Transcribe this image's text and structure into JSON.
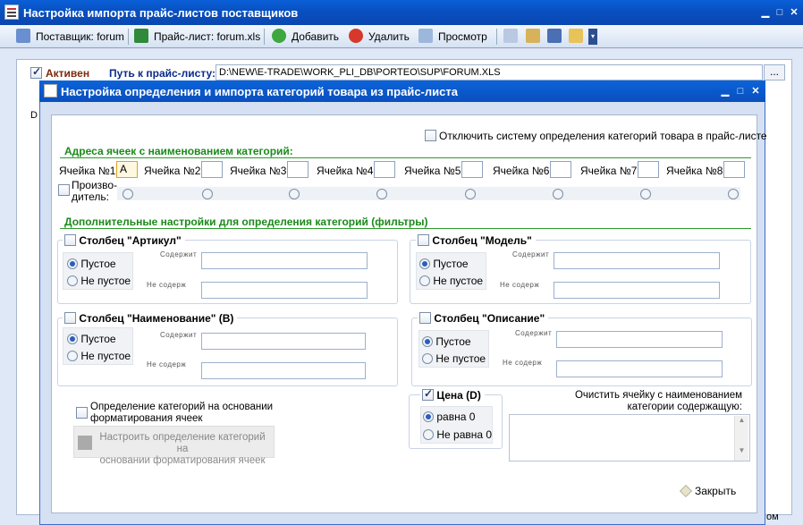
{
  "window": {
    "title": "Настройка импорта прайс-листов поставщиков"
  },
  "toolbar": {
    "supplier": "Поставщик: forum",
    "pricelist": "Прайс-лист: forum.xls",
    "add": "Добавить",
    "delete": "Удалить",
    "view": "Просмотр"
  },
  "main": {
    "active_label": "Активен",
    "path_label": "Путь к прайс-листу:",
    "path_value": "D:\\NEW\\E-TRADE\\WORK_PLI_DB\\PORTEO\\SUP\\FORUM.XLS",
    "dots": "...",
    "bg_letter_d": "D",
    "bottom_right": "ом"
  },
  "dialog": {
    "title": "Настройка определения и импорта категорий товара из прайс-листа",
    "disable_label": "Отключить систему определения категорий товара в прайс-листе",
    "cells_header": "Адреса ячеек с наименованием категорий:",
    "cells": [
      {
        "label": "Ячейка №1:",
        "value": "A"
      },
      {
        "label": "Ячейка №2:",
        "value": ""
      },
      {
        "label": "Ячейка №3:",
        "value": ""
      },
      {
        "label": "Ячейка №4:",
        "value": ""
      },
      {
        "label": "Ячейка №5:",
        "value": ""
      },
      {
        "label": "Ячейка №6:",
        "value": ""
      },
      {
        "label": "Ячейка №7:",
        "value": ""
      },
      {
        "label": "Ячейка №8:",
        "value": ""
      }
    ],
    "producer_label_1": "Произво-",
    "producer_label_2": "дитель:",
    "filters_header": "Дополнительные настройки для определения категорий (фильтры)",
    "groups": {
      "article": {
        "caption": "Столбец \"Артикул\"",
        "empty": "Пустое",
        "not_empty": "Не пустое",
        "contains": "Содержит",
        "not_contains": "Не содерж"
      },
      "model": {
        "caption": "Столбец \"Модель\"",
        "empty": "Пустое",
        "not_empty": "Не пустое",
        "contains": "Содержит",
        "not_contains": "Не содерж"
      },
      "name": {
        "caption": "Столбец \"Наименование\" (В)",
        "empty": "Пустое",
        "not_empty": "Не пустое",
        "contains": "Содержит",
        "not_contains": "Не содерж"
      },
      "description": {
        "caption": "Столбец \"Описание\"",
        "empty": "Пустое",
        "not_empty": "Не пустое",
        "contains": "Содержит",
        "not_contains": "Не содерж"
      }
    },
    "format_check_1": "Определение категорий на основании",
    "format_check_2": "форматирования ячеек",
    "format_btn_1": "Настроить определение категорий на",
    "format_btn_2": "основании форматирования ячеек",
    "price": {
      "caption": "Цена (D)",
      "eq": "равна 0",
      "neq": "Не равна 0"
    },
    "clear_label_1": "Очистить ячейку с наименованием",
    "clear_label_2": "категории содержащую:",
    "close": "Закрыть"
  }
}
